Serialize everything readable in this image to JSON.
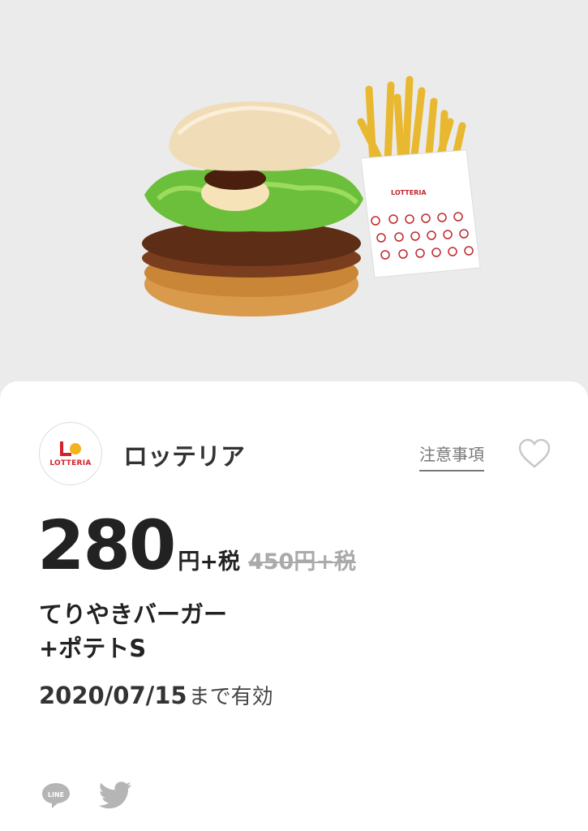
{
  "hero": {
    "image": "teriyaki-burger-and-fries-photo",
    "fries_box_brand": "LOTTERIA"
  },
  "shop": {
    "logo_text": "LOTTERIA",
    "name": "ロッテリア"
  },
  "actions": {
    "notes_label": "注意事項",
    "favorite_icon": "heart-icon"
  },
  "price": {
    "current": "280",
    "current_unit": "円+税",
    "original": "450円+税"
  },
  "product": {
    "line1": "てりやきバーガー",
    "line2": "+ポテトS"
  },
  "validity": {
    "date": "2020/07/15",
    "suffix": "まで有効"
  },
  "share": {
    "line_icon": "line-icon",
    "line_label": "LINE",
    "twitter_icon": "twitter-icon"
  },
  "colors": {
    "brand_red": "#d2232a",
    "background": "#ebebeb"
  }
}
